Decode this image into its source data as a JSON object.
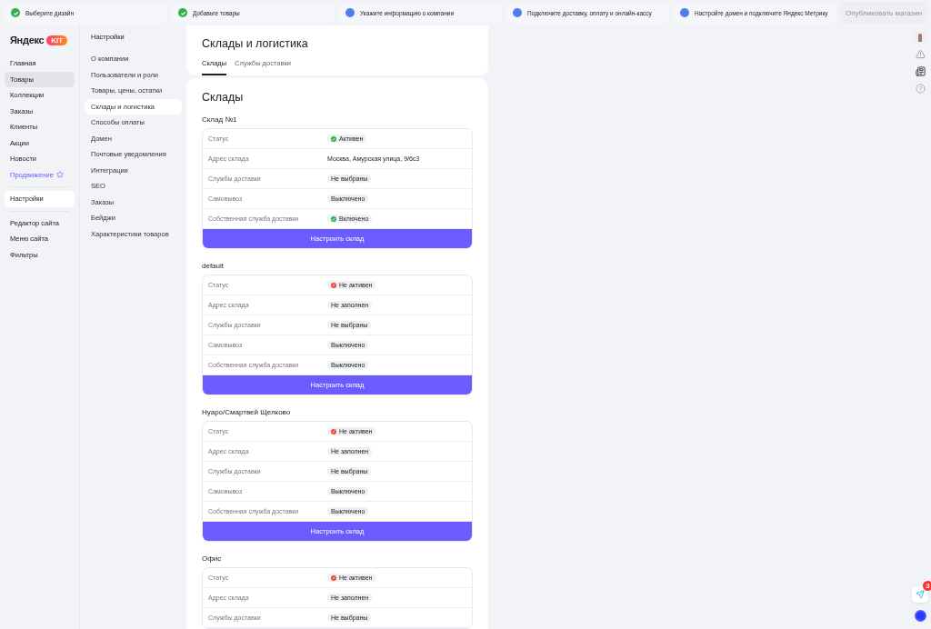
{
  "steps": [
    {
      "label": "Выберите дизайн",
      "done": true
    },
    {
      "label": "Добавьте товары",
      "done": true
    },
    {
      "label": "Укажите информацию о компании",
      "done": false
    },
    {
      "label": "Подключите доставку, оплату и онлайн-кассу",
      "done": false
    },
    {
      "label": "Настройте домен и подключите Яндекс Метрику",
      "done": false
    }
  ],
  "publish_button": {
    "label": "Опубликовать магазин",
    "disabled": true
  },
  "logo": {
    "text": "Яндекс",
    "badge": "KIT"
  },
  "nav_groups": [
    [
      {
        "label": "Главная",
        "selected": false,
        "highlighted": false,
        "kind": "plain"
      },
      {
        "label": "Товары",
        "selected": false,
        "highlighted": true,
        "kind": "plain"
      },
      {
        "label": "Коллекции",
        "selected": false,
        "highlighted": false,
        "kind": "plain"
      },
      {
        "label": "Заказы",
        "selected": false,
        "highlighted": false,
        "kind": "plain"
      },
      {
        "label": "Клиенты",
        "selected": false,
        "highlighted": false,
        "kind": "plain"
      },
      {
        "label": "Акции",
        "selected": false,
        "highlighted": false,
        "kind": "plain"
      },
      {
        "label": "Новости",
        "selected": false,
        "highlighted": false,
        "kind": "plain"
      },
      {
        "label": "Продвижение",
        "selected": false,
        "highlighted": false,
        "kind": "promo"
      }
    ],
    [
      {
        "label": "Настройки",
        "selected": true,
        "highlighted": false,
        "kind": "plain"
      }
    ],
    [
      {
        "label": "Редактор сайта",
        "selected": false,
        "highlighted": false,
        "kind": "plain"
      },
      {
        "label": "Меню сайта",
        "selected": false,
        "highlighted": false,
        "kind": "plain"
      },
      {
        "label": "Фильтры",
        "selected": false,
        "highlighted": false,
        "kind": "plain"
      }
    ]
  ],
  "settings_menu": {
    "title": "Настройки",
    "items": [
      {
        "label": "О компании",
        "selected": false
      },
      {
        "label": "Пользователи и роли",
        "selected": false
      },
      {
        "label": "Товары, цены, остатки",
        "selected": false
      },
      {
        "label": "Склады и логистика",
        "selected": true
      },
      {
        "label": "Способы оплаты",
        "selected": false
      },
      {
        "label": "Домен",
        "selected": false
      },
      {
        "label": "Почтовые уведомления",
        "selected": false
      },
      {
        "label": "Интеграции",
        "selected": false
      },
      {
        "label": "SEO",
        "selected": false
      },
      {
        "label": "Заказы",
        "selected": false
      },
      {
        "label": "Бейджи",
        "selected": false
      },
      {
        "label": "Характеристики товаров",
        "selected": false
      }
    ]
  },
  "page_title": "Склады и логистика",
  "tabs": [
    {
      "label": "Склады",
      "selected": true
    },
    {
      "label": "Службы доставки",
      "selected": false
    }
  ],
  "section_title": "Склады",
  "warehouses": [
    {
      "name": "Склад №1",
      "button": "Настроить склад",
      "rows": [
        {
          "label": "Статус",
          "value": "Активен",
          "kind": "ok"
        },
        {
          "label": "Адрес склада",
          "value": "Москва, Амурская улица, 9/6с3",
          "kind": "text"
        },
        {
          "label": "Службы доставки",
          "value": "Не выбраны",
          "kind": "chip"
        },
        {
          "label": "Самовывоз",
          "value": "Выключено",
          "kind": "chip"
        },
        {
          "label": "Собственная служба доставки",
          "value": "Включено",
          "kind": "ok"
        }
      ]
    },
    {
      "name": "default",
      "button": "Настроить склад",
      "rows": [
        {
          "label": "Статус",
          "value": "Не активен",
          "kind": "error"
        },
        {
          "label": "Адрес склада",
          "value": "Не заполнен",
          "kind": "chip"
        },
        {
          "label": "Службы доставки",
          "value": "Не выбраны",
          "kind": "chip"
        },
        {
          "label": "Самовывоз",
          "value": "Выключено",
          "kind": "chip"
        },
        {
          "label": "Собственная служба доставки",
          "value": "Выключено",
          "kind": "chip"
        }
      ]
    },
    {
      "name": "Нуаро/Смартвей Щелково",
      "button": "Настроить склад",
      "rows": [
        {
          "label": "Статус",
          "value": "Не активен",
          "kind": "error"
        },
        {
          "label": "Адрес склада",
          "value": "Не заполнен",
          "kind": "chip"
        },
        {
          "label": "Службы доставки",
          "value": "Не выбраны",
          "kind": "chip"
        },
        {
          "label": "Самовывоз",
          "value": "Выключено",
          "kind": "chip"
        },
        {
          "label": "Собственная служба доставки",
          "value": "Выключено",
          "kind": "chip"
        }
      ]
    },
    {
      "name": "Офис",
      "rows": [
        {
          "label": "Статус",
          "value": "Не активен",
          "kind": "error"
        },
        {
          "label": "Адрес склада",
          "value": "Не заполнен",
          "kind": "chip"
        },
        {
          "label": "Службы доставки",
          "value": "Не выбраны",
          "kind": "chip"
        }
      ]
    }
  ],
  "chat_badge": "3"
}
